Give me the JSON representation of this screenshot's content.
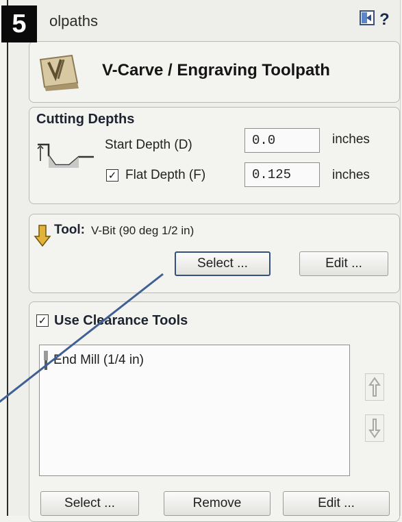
{
  "step_badge": "5",
  "panel": {
    "title": "olpaths",
    "help": "?"
  },
  "header": {
    "title": "V-Carve / Engraving Toolpath"
  },
  "cutting_depths": {
    "label": "Cutting Depths",
    "start_depth": {
      "label": "Start Depth (D)",
      "value": "0.0",
      "unit": "inches"
    },
    "flat_depth": {
      "label": "Flat Depth (F)",
      "value": "0.125",
      "unit": "inches",
      "checked": true
    }
  },
  "tool": {
    "label": "Tool:",
    "value": "V-Bit (90 deg 1/2 in)",
    "select_label": "Select ...",
    "edit_label": "Edit ..."
  },
  "clearance": {
    "label": "Use Clearance Tools",
    "checked": true,
    "items": [
      {
        "label": "End Mill (1/4 in)"
      }
    ],
    "select_label": "Select ...",
    "remove_label": "Remove",
    "edit_label": "Edit ..."
  },
  "colors": {
    "callout": "#3f5f95",
    "focus": "#36507e"
  }
}
